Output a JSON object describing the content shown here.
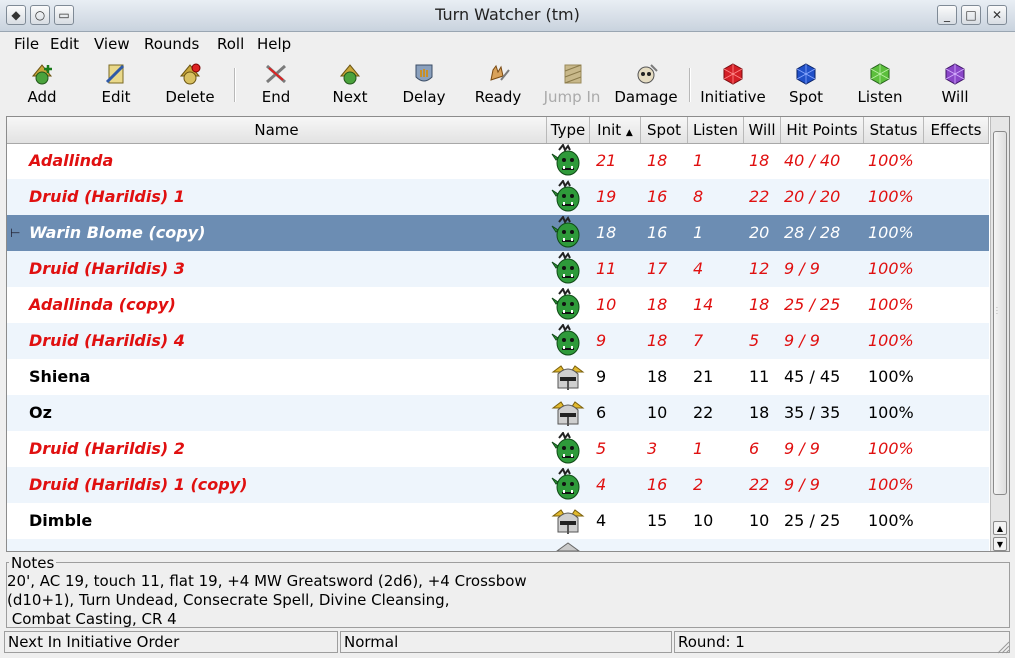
{
  "window": {
    "title": "Turn Watcher (tm)"
  },
  "menu": [
    "File",
    "Edit",
    "View",
    "Rounds",
    "Roll",
    "Help"
  ],
  "toolbar": [
    {
      "label": "Add",
      "icon": "add-icon",
      "enabled": true
    },
    {
      "label": "Edit",
      "icon": "edit-icon",
      "enabled": true
    },
    {
      "label": "Delete",
      "icon": "delete-icon",
      "enabled": true
    },
    {
      "label": "End",
      "icon": "end-icon",
      "enabled": true
    },
    {
      "label": "Next",
      "icon": "next-icon",
      "enabled": true
    },
    {
      "label": "Delay",
      "icon": "delay-icon",
      "enabled": true
    },
    {
      "label": "Ready",
      "icon": "ready-icon",
      "enabled": true
    },
    {
      "label": "Jump In",
      "icon": "jump-in-icon",
      "enabled": false
    },
    {
      "label": "Damage",
      "icon": "damage-icon",
      "enabled": true
    },
    {
      "label": "Initiative",
      "icon": "initiative-die-icon",
      "enabled": true
    },
    {
      "label": "Spot",
      "icon": "spot-die-icon",
      "enabled": true
    },
    {
      "label": "Listen",
      "icon": "listen-die-icon",
      "enabled": true
    },
    {
      "label": "Will",
      "icon": "will-die-icon",
      "enabled": true
    }
  ],
  "columns": [
    "Name",
    "Type",
    "Init",
    "Spot",
    "Listen",
    "Will",
    "Hit Points",
    "Status",
    "Effects"
  ],
  "sort_indicator": "▲",
  "rows": [
    {
      "name": "Adallinda",
      "type": "monster",
      "init": "21",
      "spot": "18",
      "listen": "1",
      "will": "18",
      "hp": "40 / 40",
      "status": "100%",
      "effects": "",
      "enemy": true,
      "selected": false
    },
    {
      "name": "Druid (Harildis) 1",
      "type": "monster",
      "init": "19",
      "spot": "16",
      "listen": "8",
      "will": "22",
      "hp": "20 / 20",
      "status": "100%",
      "effects": "",
      "enemy": true,
      "selected": false
    },
    {
      "name": "Warin Blome (copy)",
      "type": "monster",
      "init": "18",
      "spot": "16",
      "listen": "1",
      "will": "20",
      "hp": "28 / 28",
      "status": "100%",
      "effects": "",
      "enemy": true,
      "selected": true
    },
    {
      "name": "Druid (Harildis) 3",
      "type": "monster",
      "init": "11",
      "spot": "17",
      "listen": "4",
      "will": "12",
      "hp": "9 / 9",
      "status": "100%",
      "effects": "",
      "enemy": true,
      "selected": false
    },
    {
      "name": "Adallinda (copy)",
      "type": "monster",
      "init": "10",
      "spot": "18",
      "listen": "14",
      "will": "18",
      "hp": "25 / 25",
      "status": "100%",
      "effects": "",
      "enemy": true,
      "selected": false
    },
    {
      "name": "Druid (Harildis) 4",
      "type": "monster",
      "init": "9",
      "spot": "18",
      "listen": "7",
      "will": "5",
      "hp": "9 / 9",
      "status": "100%",
      "effects": "",
      "enemy": true,
      "selected": false
    },
    {
      "name": "Shiena",
      "type": "player",
      "init": "9",
      "spot": "18",
      "listen": "21",
      "will": "11",
      "hp": "45 / 45",
      "status": "100%",
      "effects": "",
      "enemy": false,
      "selected": false
    },
    {
      "name": "Oz",
      "type": "player",
      "init": "6",
      "spot": "10",
      "listen": "22",
      "will": "18",
      "hp": "35 / 35",
      "status": "100%",
      "effects": "",
      "enemy": false,
      "selected": false
    },
    {
      "name": "Druid (Harildis) 2",
      "type": "monster",
      "init": "5",
      "spot": "3",
      "listen": "1",
      "will": "6",
      "hp": "9 / 9",
      "status": "100%",
      "effects": "",
      "enemy": true,
      "selected": false
    },
    {
      "name": "Druid (Harildis) 1 (copy)",
      "type": "monster",
      "init": "4",
      "spot": "16",
      "listen": "2",
      "will": "22",
      "hp": "9 / 9",
      "status": "100%",
      "effects": "",
      "enemy": true,
      "selected": false
    },
    {
      "name": "Dimble",
      "type": "player",
      "init": "4",
      "spot": "15",
      "listen": "10",
      "will": "10",
      "hp": "25 / 25",
      "status": "100%",
      "effects": "",
      "enemy": false,
      "selected": false
    }
  ],
  "notes": {
    "label": "Notes",
    "text": "20', AC 19, touch 11, flat 19, +4 MW Greatsword (2d6), +4 Crossbow\n(d10+1), Turn Undead, Consecrate Spell, Divine Cleansing,\n Combat Casting, CR 4"
  },
  "statusbar": {
    "left": "Next In Initiative Order",
    "middle": "Normal",
    "right": "Round: 1"
  },
  "colors": {
    "enemy": "#e01010",
    "selection": "#6c8db3",
    "alt_row": "#eef5fc"
  }
}
